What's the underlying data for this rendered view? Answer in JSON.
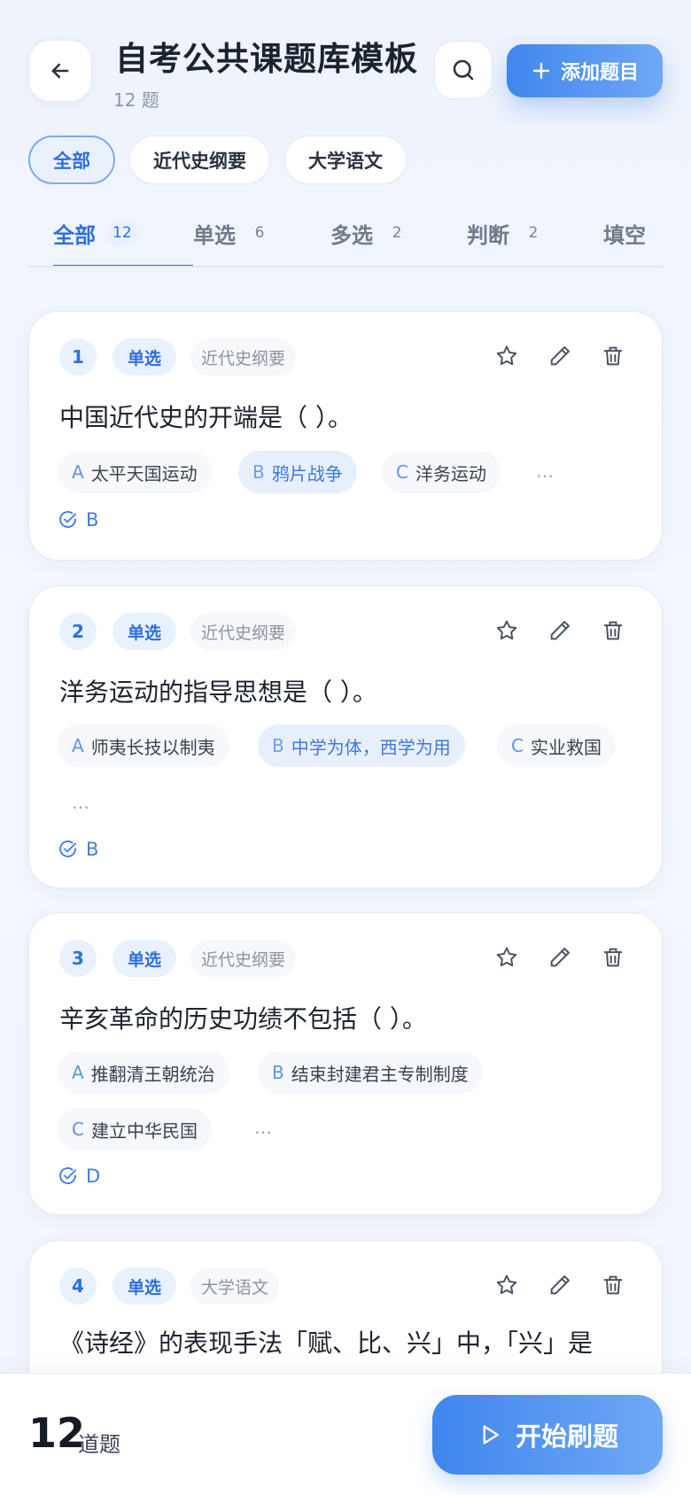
{
  "header": {
    "title": "自考公共课题库模板",
    "count_text": "12 题",
    "add_label": "添加题目"
  },
  "subject_chips": [
    "全部",
    "近代史纲要",
    "大学语文"
  ],
  "type_tabs": [
    {
      "label": "全部",
      "count": "12"
    },
    {
      "label": "单选",
      "count": "6"
    },
    {
      "label": "多选",
      "count": "2"
    },
    {
      "label": "判断",
      "count": "2"
    },
    {
      "label": "填空",
      "count": ""
    }
  ],
  "questions": [
    {
      "num": "1",
      "type": "单选",
      "subject": "近代史纲要",
      "text": "中国近代史的开端是（ ）。",
      "options": [
        {
          "letter": "A",
          "text": "太平天国运动"
        },
        {
          "letter": "B",
          "text": "鸦片战争"
        },
        {
          "letter": "C",
          "text": "洋务运动"
        }
      ],
      "more": "…",
      "answer": "B"
    },
    {
      "num": "2",
      "type": "单选",
      "subject": "近代史纲要",
      "text": "洋务运动的指导思想是（ ）。",
      "options": [
        {
          "letter": "A",
          "text": "师夷长技以制夷"
        },
        {
          "letter": "B",
          "text": "中学为体，西学为用"
        },
        {
          "letter": "C",
          "text": "实业救国"
        }
      ],
      "more": "…",
      "answer": "B"
    },
    {
      "num": "3",
      "type": "单选",
      "subject": "近代史纲要",
      "text": "辛亥革命的历史功绩不包括（ ）。",
      "options": [
        {
          "letter": "A",
          "text": "推翻清王朝统治"
        },
        {
          "letter": "B",
          "text": "结束封建君主专制制度"
        },
        {
          "letter": "C",
          "text": "建立中华民国"
        }
      ],
      "more": "…",
      "answer": "D"
    },
    {
      "num": "4",
      "type": "单选",
      "subject": "大学语文",
      "text": "《诗经》的表现手法「赋、比、兴」中，「兴」是"
    }
  ],
  "footer": {
    "total": "12",
    "total_label": "道题",
    "start_label": "开始刷题"
  },
  "colors": {
    "accent": "#2e6fdc",
    "accent_gradient_start": "#3f86ee",
    "accent_gradient_end": "#6fa8f6",
    "chip_active_bg": "#e9f1fe"
  },
  "icons": [
    "arrow-left-icon",
    "search-icon",
    "plus-icon",
    "star-icon",
    "pencil-icon",
    "trash-icon",
    "check-circle-icon",
    "play-icon"
  ]
}
